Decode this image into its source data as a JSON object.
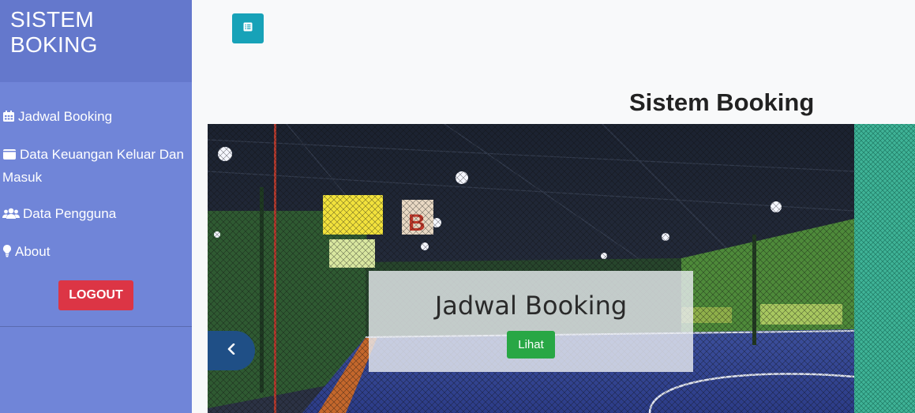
{
  "sidebar": {
    "brand": "SISTEM BOKING",
    "items": [
      {
        "label": "Jadwal Booking",
        "icon": "calendar-icon"
      },
      {
        "label": "Data Keuangan Keluar Dan Masuk",
        "icon": "wallet-icon"
      },
      {
        "label": "Data Pengguna",
        "icon": "users-icon"
      },
      {
        "label": "About",
        "icon": "lightbulb-icon"
      }
    ],
    "logout_label": "LOGOUT"
  },
  "topbar": {
    "toggle_icon": "sidebar-toggle-icon"
  },
  "main": {
    "title": "Sistem Booking",
    "carousel": {
      "caption_title": "Jadwal Booking",
      "caption_button": "Lihat",
      "prev_icon": "chevron-left-icon"
    }
  },
  "colors": {
    "sidebar": "#7085d8",
    "brand_bg": "#6478cc",
    "logout": "#dc3545",
    "toggle": "#17a2b8",
    "caption_button": "#28a745",
    "prev_button": "#1f4f86"
  }
}
